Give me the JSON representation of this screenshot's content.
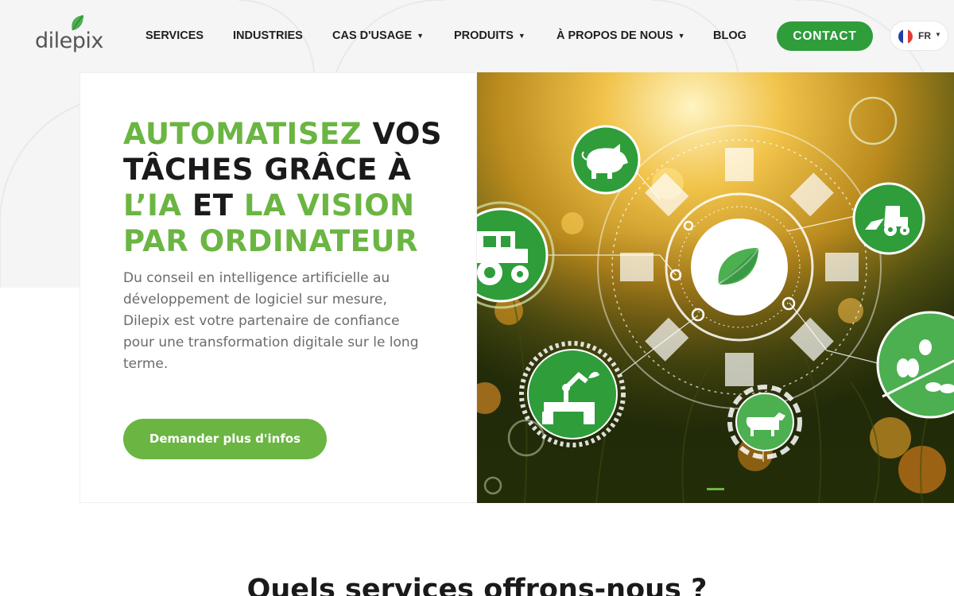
{
  "brand": {
    "name": "dilepix",
    "leaf_color": "#4caf50"
  },
  "nav": {
    "items": [
      {
        "label": "SERVICES",
        "has_dropdown": false
      },
      {
        "label": "INDUSTRIES",
        "has_dropdown": false
      },
      {
        "label": "CAS D'USAGE",
        "has_dropdown": true
      },
      {
        "label": "PRODUITS",
        "has_dropdown": true
      },
      {
        "label": "À PROPOS DE NOUS",
        "has_dropdown": true
      },
      {
        "label": "BLOG",
        "has_dropdown": false
      }
    ],
    "contact_label": "CONTACT",
    "language": {
      "code": "FR",
      "flag_icon": "france-flag-icon"
    }
  },
  "hero": {
    "headline": [
      {
        "text": "AUTOMATISEZ",
        "color": "green"
      },
      {
        "text": " VOS TÂCHES GRÂCE À ",
        "color": "dark"
      },
      {
        "text": "L’IA",
        "color": "green"
      },
      {
        "text": " ET ",
        "color": "dark"
      },
      {
        "text": "LA VISION PAR ORDINATEUR",
        "color": "green"
      }
    ],
    "lead": "Du conseil en intelligence artificielle au développement de logiciel sur mesure, Dilepix est votre partenaire de confiance  pour une transformation digitale sur le long terme.",
    "cta_label": "Demander plus d'infos",
    "image_icons": [
      "pig-icon",
      "tractor-icon",
      "loader-tractor-icon",
      "leaf-icon",
      "robot-arm-icon",
      "cow-icon",
      "insects-icon"
    ]
  },
  "services": {
    "title": "Quels services offrons-nous ?"
  },
  "colors": {
    "accent": "#6bb543",
    "contact_button": "#2e9d3a",
    "text_dark": "#1a1a1a",
    "text_muted": "#6b6b6b"
  }
}
